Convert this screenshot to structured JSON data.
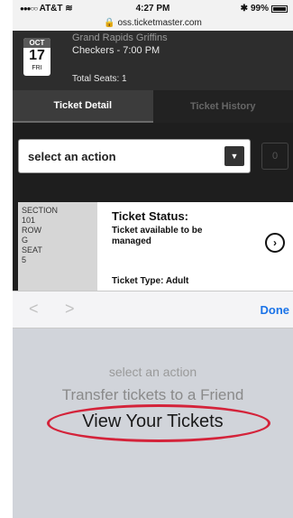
{
  "status_bar": {
    "carrier": "AT&T",
    "time": "4:27 PM",
    "battery": "99%"
  },
  "url": "oss.ticketmaster.com",
  "event": {
    "date": {
      "month": "OCT",
      "day": "17",
      "weekday": "FRI"
    },
    "teams": "Grand Rapids Griffins",
    "line2": "Checkers - 7:00 PM",
    "total_seats": "Total Seats: 1"
  },
  "tabs": [
    {
      "label": "Ticket Detail",
      "active": true
    },
    {
      "label": "Ticket History",
      "active": false
    }
  ],
  "action_select": {
    "value": "select an action",
    "count": "0"
  },
  "ticket": {
    "section_label": "SECTION",
    "section_value": "101",
    "row_label": "ROW",
    "row_value": "G",
    "seat_label": "SEAT",
    "seat_value": "5",
    "status_title": "Ticket Status:",
    "status_text": "Ticket available to be managed",
    "type": "Ticket Type: Adult"
  },
  "picker_toolbar": {
    "prev": "<",
    "next": ">",
    "done": "Done"
  },
  "picker_options": [
    "select an action",
    "Transfer tickets to a Friend",
    "View Your Tickets"
  ],
  "colors": {
    "done_blue": "#1a73e8",
    "highlight_red": "#d4233a"
  },
  "icons": {
    "dropdown": "triangle-down-icon",
    "ticket_arrow": "chevron-right-circle-icon",
    "lock": "lock-icon"
  }
}
